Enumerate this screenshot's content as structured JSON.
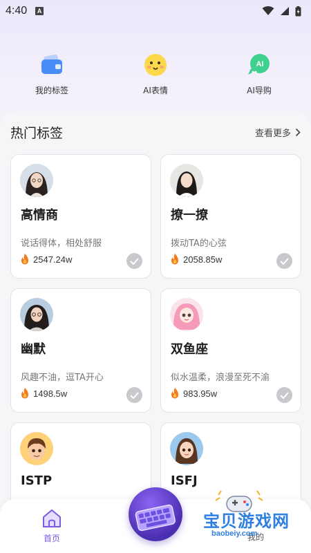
{
  "status_bar": {
    "time": "4:40",
    "badge": "A"
  },
  "quick_actions": [
    {
      "label": "我的标签",
      "icon": "wallet-icon"
    },
    {
      "label": "AI表情",
      "icon": "emoji-face-icon"
    },
    {
      "label": "AI导购",
      "icon": "ai-chat-icon"
    }
  ],
  "section": {
    "title": "热门标签",
    "more": "查看更多"
  },
  "cards": [
    {
      "title": "高情商",
      "desc": "说话得体，相处舒服",
      "count": "2547.24w",
      "avatar": "avatar-girl-1"
    },
    {
      "title": "撩一撩",
      "desc": "拨动TA的心弦",
      "count": "2058.85w",
      "avatar": "avatar-girl-2"
    },
    {
      "title": "幽默",
      "desc": "风趣不油，逗TA开心",
      "count": "1498.5w",
      "avatar": "avatar-girl-3"
    },
    {
      "title": "双鱼座",
      "desc": "似水温柔，浪漫至死不渝",
      "count": "983.95w",
      "avatar": "avatar-pink-hair"
    },
    {
      "title": "ISTP",
      "desc": "",
      "count": "",
      "avatar": "avatar-boy"
    },
    {
      "title": "ISFJ",
      "desc": "",
      "count": "",
      "avatar": "avatar-girl-4"
    }
  ],
  "tab_bar": {
    "home": "首页",
    "right": "我的"
  },
  "watermark": {
    "title": "宝贝游戏网",
    "url": "baobeiy.com"
  },
  "colors": {
    "accent": "#7a5be6",
    "fire": "#f47a1f",
    "check": "#c9c9cd"
  }
}
